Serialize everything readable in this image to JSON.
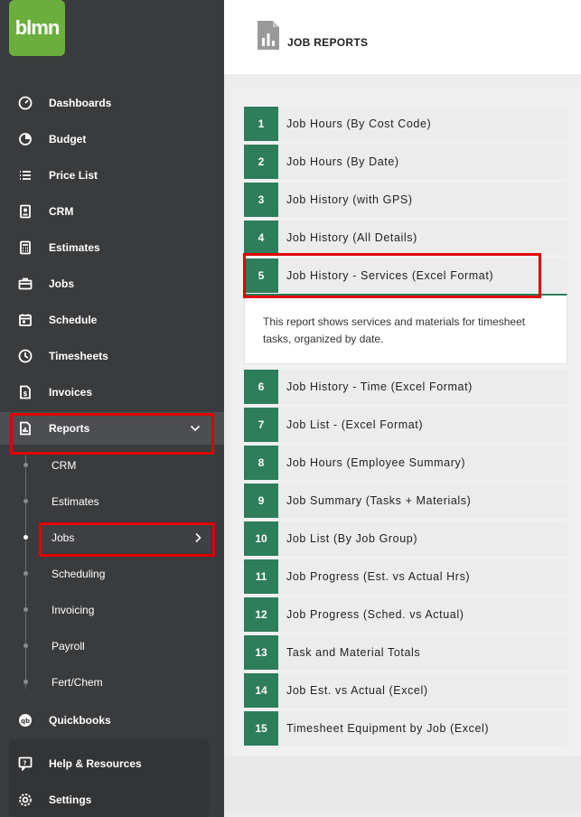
{
  "logo": {
    "text": "blmn"
  },
  "sidebar": {
    "items": [
      {
        "label": "Dashboards",
        "icon": "gauge-icon"
      },
      {
        "label": "Budget",
        "icon": "pie-chart-icon"
      },
      {
        "label": "Price List",
        "icon": "list-icon"
      },
      {
        "label": "CRM",
        "icon": "contact-card-icon"
      },
      {
        "label": "Estimates",
        "icon": "calculator-icon"
      },
      {
        "label": "Jobs",
        "icon": "briefcase-icon"
      },
      {
        "label": "Schedule",
        "icon": "calendar-icon"
      },
      {
        "label": "Timesheets",
        "icon": "clock-icon"
      },
      {
        "label": "Invoices",
        "icon": "invoice-icon"
      },
      {
        "label": "Reports",
        "icon": "report-icon"
      }
    ],
    "reports_sub": [
      "CRM",
      "Estimates",
      "Jobs",
      "Scheduling",
      "Invoicing",
      "Payroll",
      "Fert/Chem"
    ],
    "quickbooks": "Quickbooks",
    "help": "Help & Resources",
    "settings": "Settings"
  },
  "header": {
    "title": "JOB REPORTS"
  },
  "reports": [
    {
      "num": "1",
      "title": "Job Hours (By Cost Code)"
    },
    {
      "num": "2",
      "title": "Job Hours (By Date)"
    },
    {
      "num": "3",
      "title": "Job History (with GPS)"
    },
    {
      "num": "4",
      "title": "Job History (All Details)"
    },
    {
      "num": "5",
      "title": "Job History - Services (Excel Format)"
    },
    {
      "num": "6",
      "title": "Job History - Time (Excel Format)"
    },
    {
      "num": "7",
      "title": "Job List - (Excel Format)"
    },
    {
      "num": "8",
      "title": "Job Hours (Employee Summary)"
    },
    {
      "num": "9",
      "title": "Job Summary (Tasks + Materials)"
    },
    {
      "num": "10",
      "title": "Job List (By Job Group)"
    },
    {
      "num": "11",
      "title": "Job Progress (Est. vs Actual Hrs)"
    },
    {
      "num": "12",
      "title": "Job Progress (Sched. vs Actual)"
    },
    {
      "num": "13",
      "title": "Task and Material Totals"
    },
    {
      "num": "14",
      "title": "Job Est. vs Actual (Excel)"
    },
    {
      "num": "15",
      "title": "Timesheet Equipment by Job (Excel)"
    }
  ],
  "expanded_description": "This report shows services and materials for timesheet tasks, organized by date.",
  "colors": {
    "accent": "#2e7d5b",
    "brand": "#6aaf3d",
    "sidebar": "#3a3b3d",
    "highlight": "#e00000"
  }
}
